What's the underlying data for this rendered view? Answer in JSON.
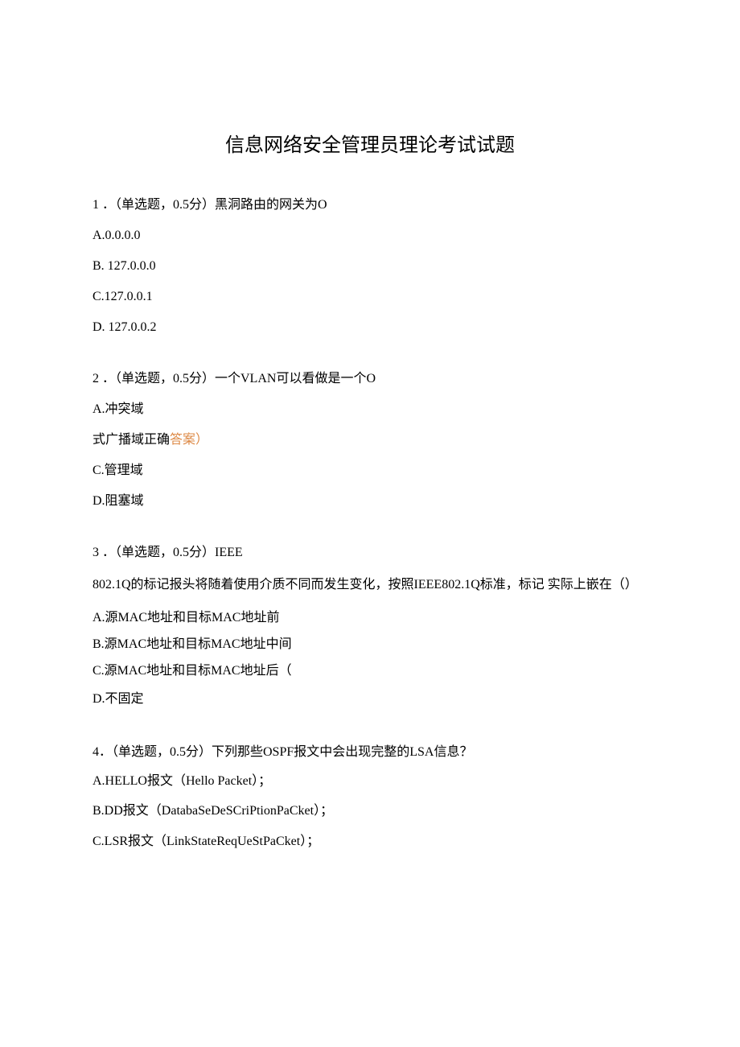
{
  "title": "信息网络安全管理员理论考试试题",
  "questions": [
    {
      "number": "1",
      "stem": "．（单选题，0.5分）黑洞路由的网关为O",
      "options": [
        {
          "text": "A.0.0.0.0"
        },
        {
          "text": "B. 127.0.0.0"
        },
        {
          "text": "C.127.0.0.1"
        },
        {
          "text": "D. 127.0.0.2"
        }
      ]
    },
    {
      "number": "2",
      "stem": "．（单选题，0.5分）一个VLAN可以看做是一个O",
      "options": [
        {
          "text": "A.冲突域"
        },
        {
          "prefix": "式广播域正确",
          "answer": "答案）"
        },
        {
          "text": "C.管理域"
        },
        {
          "text": "D.阻塞域"
        }
      ]
    },
    {
      "number": "3",
      "stem": "．（单选题，0.5分）IEEE",
      "extra": "802.1Q的标记报头将随着使用介质不同而发生变化，按照IEEE802.1Q标准，标记 实际上嵌在（）",
      "options": [
        {
          "text": "A.源MAC地址和目标MAC地址前"
        },
        {
          "text": "B.源MAC地址和目标MAC地址中间"
        },
        {
          "text": "C.源MAC地址和目标MAC地址后（"
        },
        {
          "text": "D.不固定"
        }
      ]
    },
    {
      "number": "4",
      "stem": "．（单选题，0.5分）下列那些OSPF报文中会出现完整的LSA信息？",
      "options": [
        {
          "text": "A.HELLO报文（Hello Packet）；"
        },
        {
          "text": "B.DD报文（DatabaSeDeSCriPtionPaCket）；"
        },
        {
          "text": "C.LSR报文（LinkStateReqUeStPaCket）；"
        }
      ]
    }
  ]
}
